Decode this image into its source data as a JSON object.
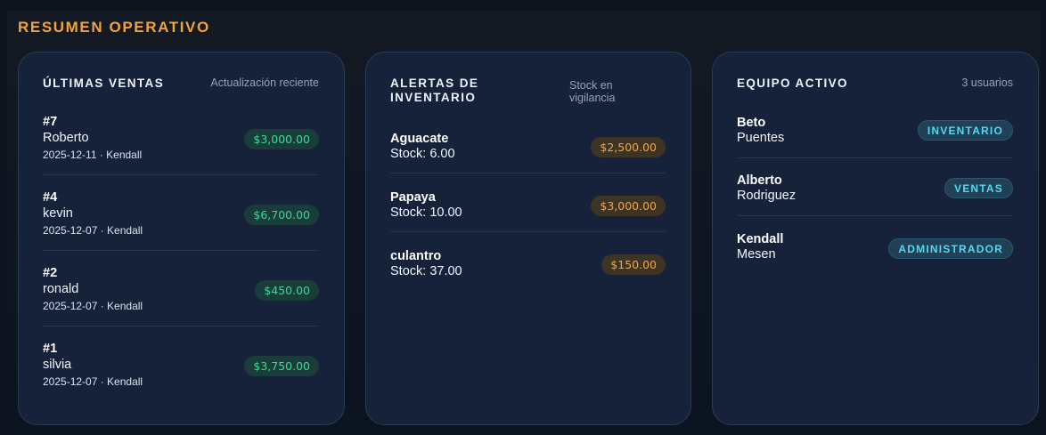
{
  "section": {
    "title": "RESUMEN OPERATIVO"
  },
  "sales": {
    "title": "ÚLTIMAS VENTAS",
    "subtitle": "Actualización reciente",
    "items": [
      {
        "id": "#7",
        "customer": "Roberto",
        "meta": "2025-12-11 · Kendall",
        "amount": "$3,000.00"
      },
      {
        "id": "#4",
        "customer": "kevin",
        "meta": "2025-12-07 · Kendall",
        "amount": "$6,700.00"
      },
      {
        "id": "#2",
        "customer": "ronald",
        "meta": "2025-12-07 · Kendall",
        "amount": "$450.00"
      },
      {
        "id": "#1",
        "customer": "silvia",
        "meta": "2025-12-07 · Kendall",
        "amount": "$3,750.00"
      }
    ]
  },
  "inventory": {
    "title_line1": "ALERTAS DE",
    "title_line2": "INVENTARIO",
    "subtitle_line1": "Stock en",
    "subtitle_line2": "vigilancia",
    "items": [
      {
        "name": "Aguacate",
        "stock": "Stock: 6.00",
        "price": "$2,500.00"
      },
      {
        "name": "Papaya",
        "stock": "Stock: 10.00",
        "price": "$3,000.00"
      },
      {
        "name": "culantro",
        "stock": "Stock: 37.00",
        "price": "$150.00"
      }
    ]
  },
  "team": {
    "title": "EQUIPO ACTIVO",
    "subtitle": "3 usuarios",
    "members": [
      {
        "first": "Beto",
        "last": "Puentes",
        "role": "INVENTARIO"
      },
      {
        "first": "Alberto",
        "last": "Rodriguez",
        "role": "VENTAS"
      },
      {
        "first": "Kendall",
        "last": "Mesen",
        "role": "ADMINISTRADOR"
      }
    ]
  },
  "colors": {
    "accent": "#f2a33a",
    "card": "#16223a",
    "sale_pill_text": "#3fd69a",
    "stock_pill_text": "#f5a53c",
    "role_pill_text": "#56d7f0"
  }
}
